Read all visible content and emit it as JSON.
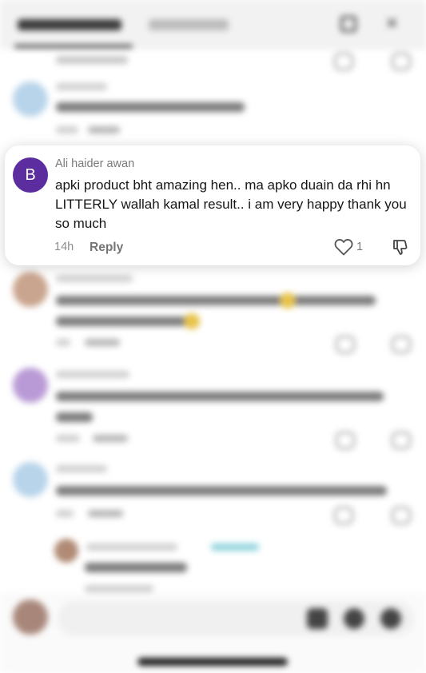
{
  "highlighted_comment": {
    "avatar_initial": "B",
    "avatar_color": "#5c2d9f",
    "author": "Ali haider awan",
    "text": "apki product bht amazing hen.. ma apko duain da rhi hn LITTERLY wallah kamal result.. i am very happy thank you so much",
    "time": "14h",
    "reply_label": "Reply",
    "likes": "1"
  },
  "icons": {
    "like": "heart-icon",
    "dislike": "thumbs-down-icon"
  }
}
